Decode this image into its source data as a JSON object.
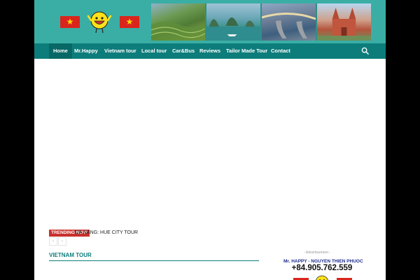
{
  "header": {
    "flag_icon": "vietnam-flag-icon",
    "mascot_icon": "mr-happy-smiley-icon",
    "banner_icons": [
      "rice-terraces-photo",
      "ha-long-bay-photo",
      "golden-bridge-photo",
      "cathedral-photo"
    ]
  },
  "nav": {
    "items": [
      {
        "label": "Home",
        "active": true
      },
      {
        "label": "Mr.Happy"
      },
      {
        "label": "Vietnam tour"
      },
      {
        "label": "Local tour"
      },
      {
        "label": "Car&Bus"
      },
      {
        "label": "Reviews"
      },
      {
        "label": "Tailor Made Tour"
      },
      {
        "label": "Contact"
      }
    ],
    "search_icon": "search-icon"
  },
  "ticker": {
    "badge": "TRENDING NOW",
    "headline": "DA NANG: HUE CITY TOUR",
    "prev": "‹",
    "next": "›"
  },
  "section": {
    "title": "VIETNAM TOUR"
  },
  "sidebar": {
    "ad_label": "- Advertisement -",
    "contact_name": "Mr. HAPPY - NGUYEN THIEN PHUOC",
    "contact_phone": "+84.905.762.559"
  },
  "colors": {
    "header_bg": "#3aaea5",
    "nav_bg": "#0d7d7b",
    "nav_active_bg": "#076866",
    "accent_red": "#da251d",
    "star_yellow": "#ffde00",
    "contact_blue": "#1d2c8e"
  }
}
